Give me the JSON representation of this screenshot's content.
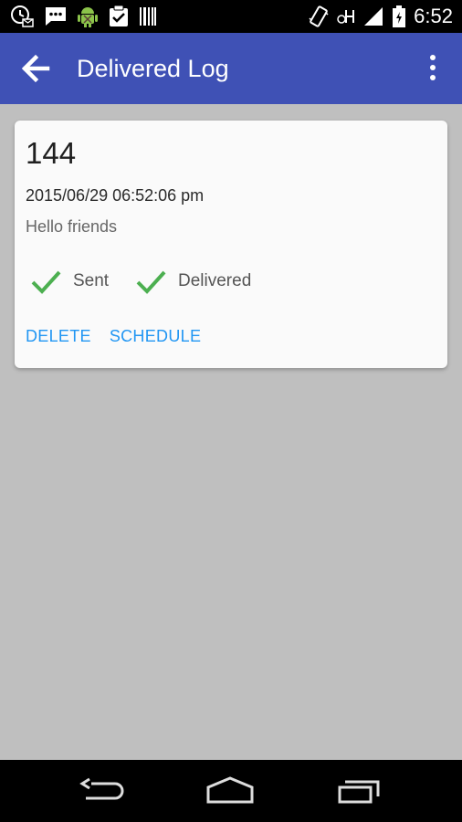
{
  "status_bar": {
    "time": "6:52",
    "icons_left": [
      "clock-sms-icon",
      "message-icon",
      "android-debug-icon",
      "clipboard-check-icon",
      "barcode-icon"
    ],
    "icons_right": [
      "vibrate-icon",
      "network-h-icon",
      "signal-icon",
      "battery-icon"
    ]
  },
  "app_bar": {
    "title": "Delivered Log",
    "color": "#3f51b5"
  },
  "card": {
    "id": "144",
    "datetime": "2015/06/29 06:52:06 pm",
    "message": "Hello friends",
    "status": [
      {
        "label": "Sent",
        "icon": "check-icon",
        "color": "#4caf50"
      },
      {
        "label": "Delivered",
        "icon": "check-icon",
        "color": "#4caf50"
      }
    ],
    "actions": {
      "delete": "DELETE",
      "schedule": "SCHEDULE",
      "color": "#2196f3"
    }
  },
  "nav_bar": {
    "buttons": [
      "back-nav-icon",
      "home-nav-icon",
      "recents-nav-icon"
    ]
  }
}
